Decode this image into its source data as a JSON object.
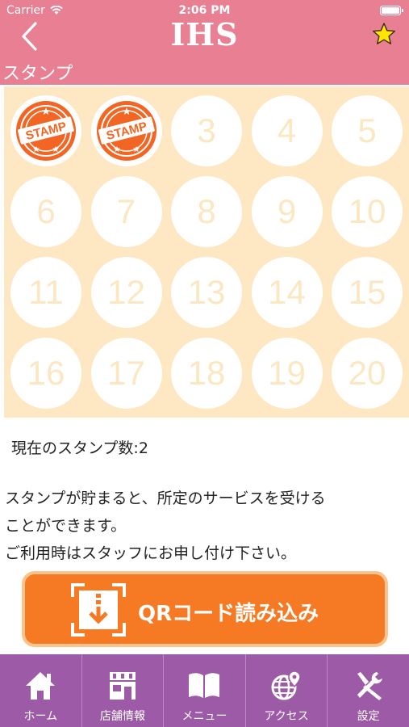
{
  "status_bar": {
    "carrier": "Carrier",
    "time": "2:06 PM"
  },
  "header": {
    "title": "IHS",
    "subtitle": "スタンプ"
  },
  "stamps": {
    "slots": [
      {
        "label": "STAMP",
        "stamped": true
      },
      {
        "label": "STAMP",
        "stamped": true
      },
      {
        "label": "3",
        "stamped": false
      },
      {
        "label": "4",
        "stamped": false
      },
      {
        "label": "5",
        "stamped": false
      },
      {
        "label": "6",
        "stamped": false
      },
      {
        "label": "7",
        "stamped": false
      },
      {
        "label": "8",
        "stamped": false
      },
      {
        "label": "9",
        "stamped": false
      },
      {
        "label": "10",
        "stamped": false
      },
      {
        "label": "11",
        "stamped": false
      },
      {
        "label": "12",
        "stamped": false
      },
      {
        "label": "13",
        "stamped": false
      },
      {
        "label": "14",
        "stamped": false
      },
      {
        "label": "15",
        "stamped": false
      },
      {
        "label": "16",
        "stamped": false
      },
      {
        "label": "17",
        "stamped": false
      },
      {
        "label": "18",
        "stamped": false
      },
      {
        "label": "19",
        "stamped": false
      },
      {
        "label": "20",
        "stamped": false
      }
    ]
  },
  "info": {
    "count_text": "現在のスタンプ数:2",
    "desc_line1": "スタンプが貯まると、所定のサービスを受ける",
    "desc_line2": "ことができます。",
    "desc_line3": "ご利用時はスタッフにお申し付け下さい。"
  },
  "qr_button": {
    "label": "QRコード読み込み"
  },
  "tabbar": {
    "items": [
      {
        "label": "ホーム",
        "icon": "home-icon"
      },
      {
        "label": "店舗情報",
        "icon": "store-icon"
      },
      {
        "label": "メニュー",
        "icon": "book-icon"
      },
      {
        "label": "アクセス",
        "icon": "globe-pin-icon"
      },
      {
        "label": "設定",
        "icon": "tools-icon"
      }
    ]
  },
  "colors": {
    "header": "#e87f92",
    "stamp_area": "#fde8c3",
    "stamp_orange": "#f26522",
    "qr_button": "#f57a23",
    "tabbar": "#9d5aa6"
  }
}
